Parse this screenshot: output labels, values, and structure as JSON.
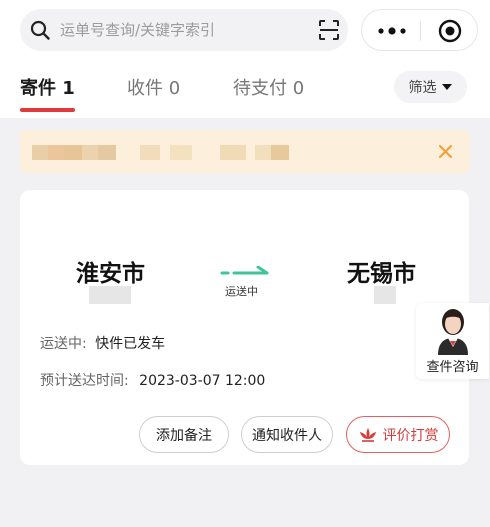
{
  "search": {
    "placeholder": "运单号查询/关键字索引",
    "icon": "search-icon",
    "scan_icon": "scan-icon"
  },
  "capsule": {
    "more_icon": "more-dots-icon",
    "close_icon": "target-circle-icon"
  },
  "tabs": [
    {
      "label": "寄件 1",
      "active": true
    },
    {
      "label": "收件 0",
      "active": false
    },
    {
      "label": "待支付 0",
      "active": false
    }
  ],
  "filter": {
    "label": "筛选",
    "icon": "triangle-down-icon"
  },
  "notice": {
    "close_icon": "close-icon"
  },
  "shipment": {
    "from_city": "淮安市",
    "to_city": "无锡市",
    "transit_label": "运送中",
    "status_key": "运送中:",
    "status_value": "快件已发车",
    "eta_key": "预计送达时间:",
    "eta_value": "2023-03-07 12:00"
  },
  "actions": {
    "add_note": "添加备注",
    "notify_receiver": "通知收件人",
    "reward": "评价打赏"
  },
  "consult": {
    "label": "查件咨询"
  },
  "colors": {
    "accent_red": "#e03a3a",
    "transit_green": "#3cc49a",
    "notice_bg": "#fcf0dc",
    "notice_close": "#f0a23a"
  }
}
